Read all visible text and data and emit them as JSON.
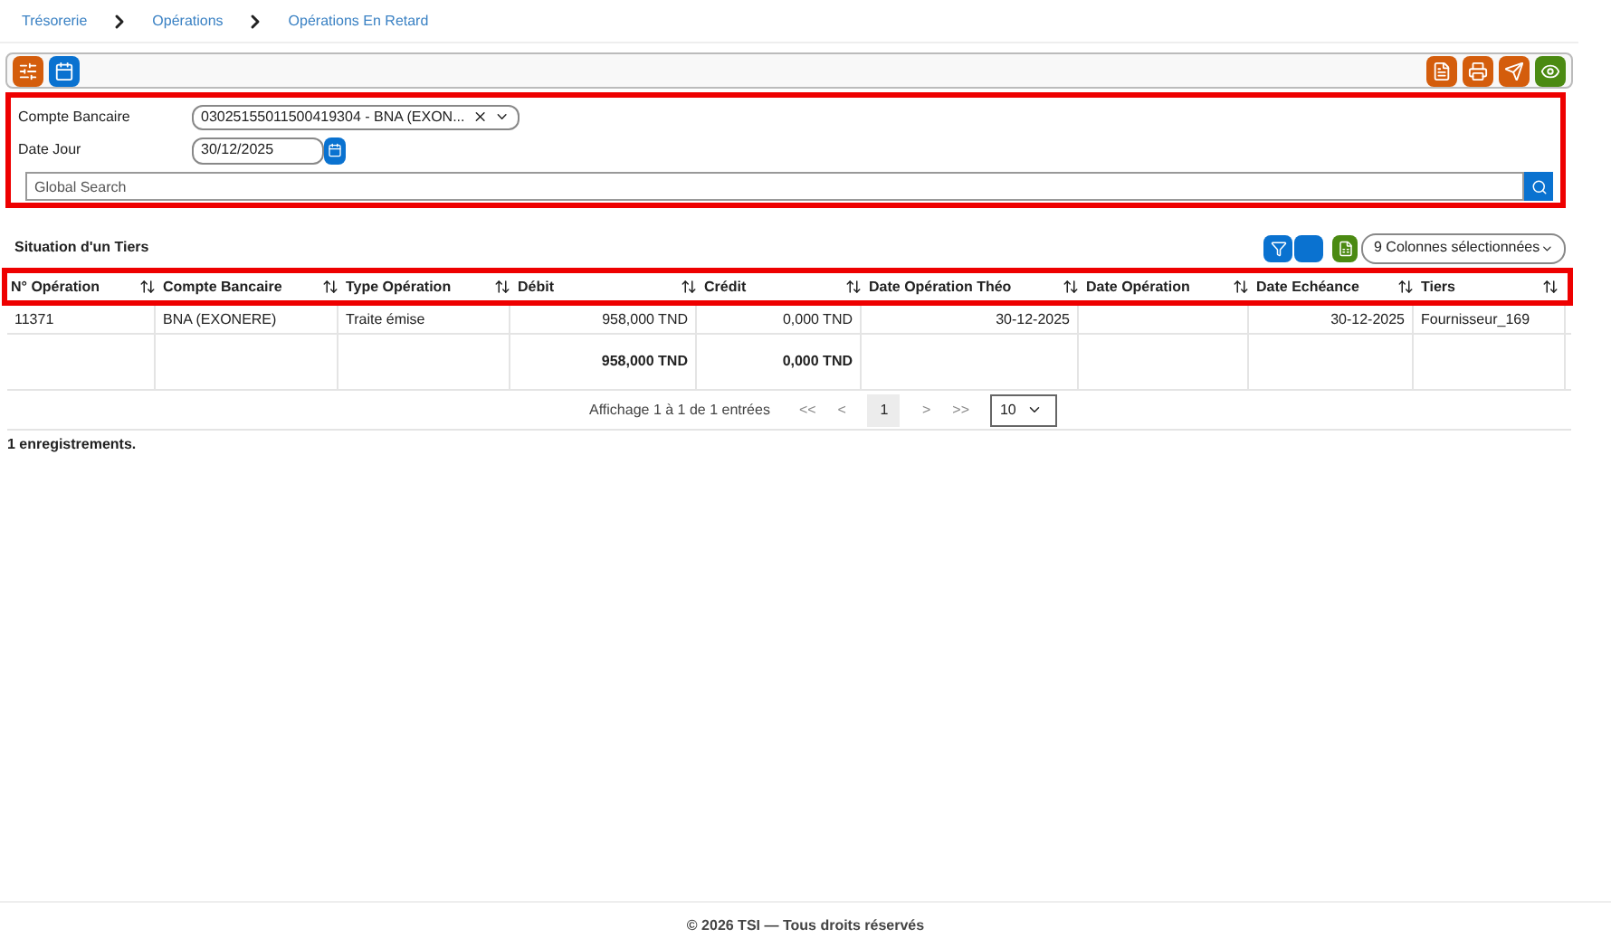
{
  "breadcrumb": [
    "Trésorerie",
    "Opérations",
    "Opérations En Retard"
  ],
  "form": {
    "account_label": "Compte Bancaire",
    "account_value": "03025155011500419304 - BNA (EXON...",
    "date_label": "Date Jour",
    "date_value": "30/12/2025",
    "search": {
      "placeholder": "Global Search"
    }
  },
  "table": {
    "title": "Situation d'un Tiers",
    "columns_select": "9 Colonnes sélectionnées",
    "columns": [
      {
        "label": "N° Opération",
        "kind": "text"
      },
      {
        "label": "Compte Bancaire",
        "kind": "text"
      },
      {
        "label": "Type Opération",
        "kind": "text"
      },
      {
        "label": "Débit",
        "kind": "amount"
      },
      {
        "label": "Crédit",
        "kind": "amount"
      },
      {
        "label": "Date Opération Théo",
        "kind": "date"
      },
      {
        "label": "Date Opération",
        "kind": "date"
      },
      {
        "label": "Date Echéance",
        "kind": "date"
      },
      {
        "label": "Tiers",
        "kind": "text"
      }
    ],
    "rows": [
      [
        "11371",
        "BNA (EXONERE)",
        "Traite émise",
        "958,000 TND",
        "0,000 TND",
        "30-12-2025",
        null,
        "30-12-2025",
        "Fournisseur_169"
      ]
    ],
    "totals": {
      "debit": "958,000 TND",
      "credit": "0,000 TND"
    },
    "pagination": {
      "info": "Affichage 1 à 1 de 1 entrées",
      "first": "<<",
      "prev": "<",
      "pages": [
        {
          "label": "1",
          "selected": true
        }
      ],
      "next": ">",
      "last": ">>",
      "page_size": "10"
    },
    "count": "1 enregistrements."
  },
  "footer": "© 2026 TSI — Tous droits réservés"
}
